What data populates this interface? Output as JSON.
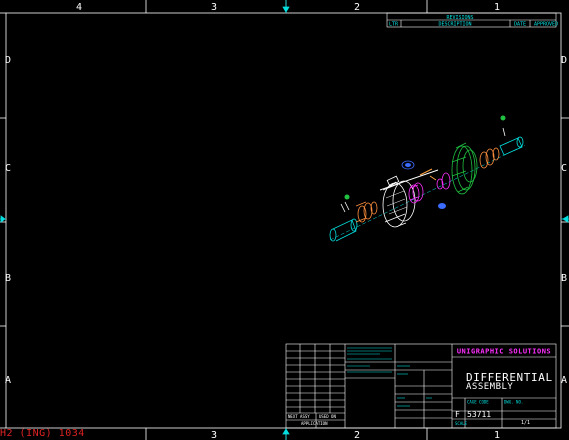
{
  "colors": {
    "border": "#ffffff",
    "accent_cyan": "#00e0e0",
    "accent_magenta": "#ff30ff",
    "accent_green": "#20c040",
    "accent_blue": "#3b6bff",
    "status_red": "#dd2222"
  },
  "zone_labels": {
    "top": [
      "4",
      "3",
      "2",
      "1"
    ],
    "bottom": [
      "3",
      "2",
      "1"
    ],
    "left": [
      "D",
      "C",
      "B",
      "A"
    ],
    "right": [
      "D",
      "C",
      "B",
      "A"
    ]
  },
  "revision_block": {
    "title": "REVISIONS",
    "headers": [
      "LTR",
      "DESCRIPTION",
      "DATE",
      "APPROVED"
    ]
  },
  "title_block": {
    "company": "UNIGRAPHIC SOLUTIONS",
    "drawing_title_line1": "DIFFERENTIAL",
    "drawing_title_line2": "ASSEMBLY",
    "size": "F",
    "dwg_no": "53711",
    "sheet": "1/1",
    "next_assy": "NEXT ASSY",
    "used_on": "USED ON",
    "application": "APPLICATION",
    "cage_label": "CAGE CODE",
    "dwg_no_label": "DWG. NO.",
    "scale_label": "SCALE",
    "sheet_label": "SHEET"
  },
  "status_bar": {
    "text": "H2 (ING) 1034"
  }
}
